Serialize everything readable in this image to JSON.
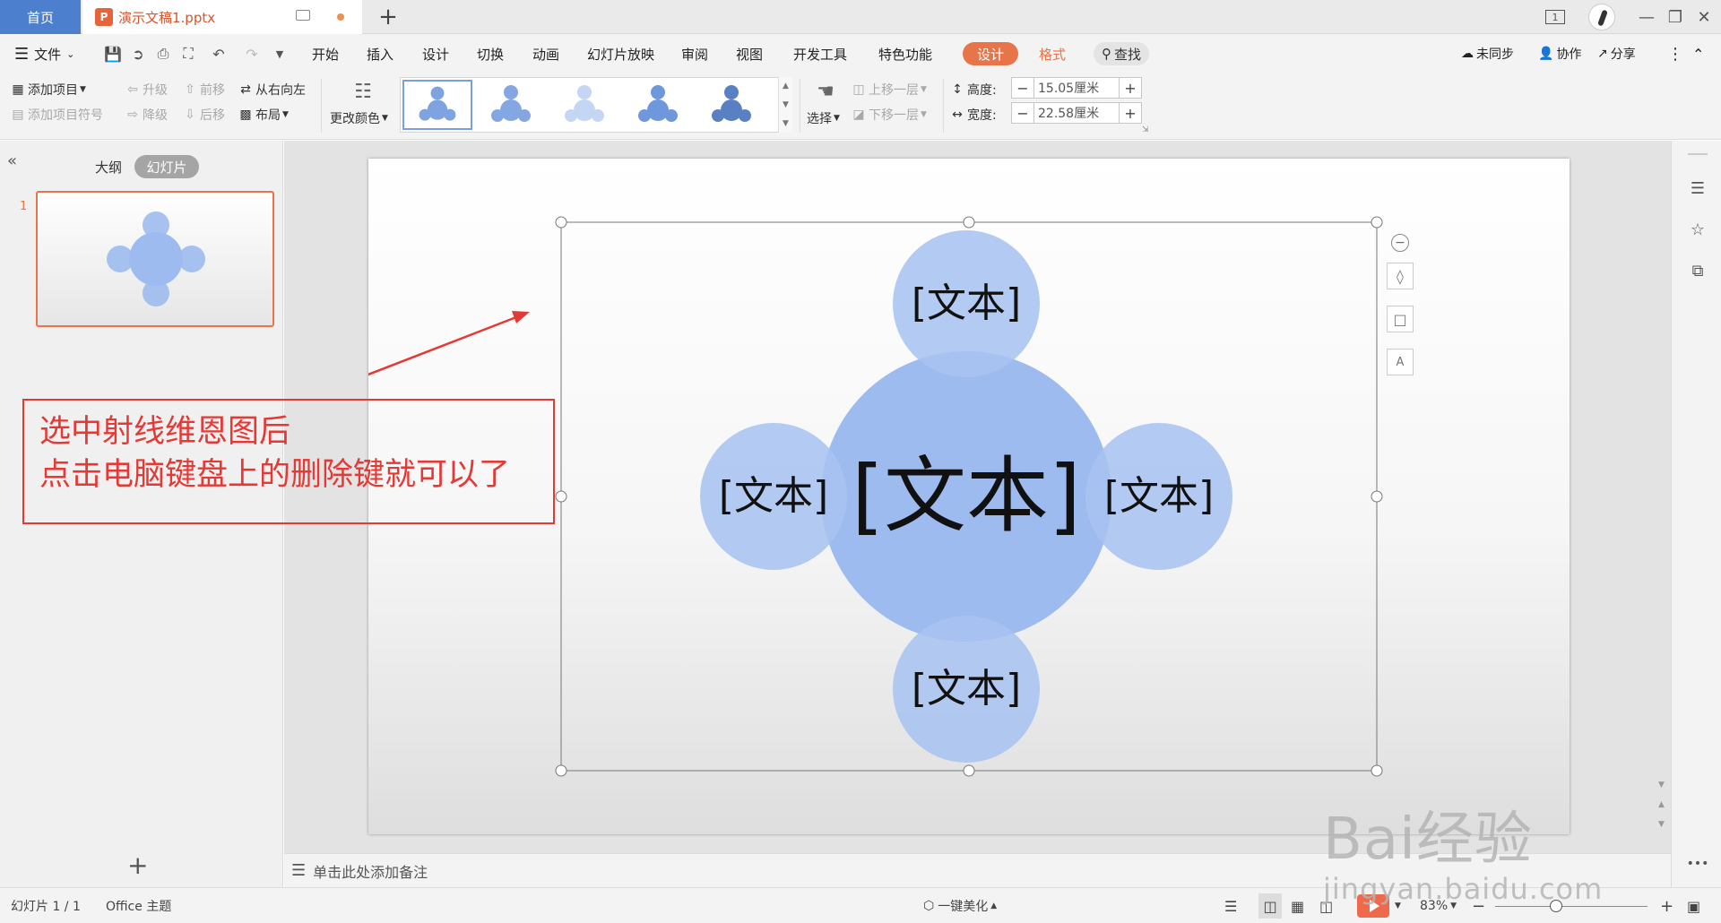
{
  "titlebar": {
    "home_tab": "首页",
    "doc_icon": "P",
    "doc_name": "演示文稿1.pptx",
    "new_tab": "+",
    "page_badge": "1"
  },
  "menu": {
    "file": "文件",
    "tabs": [
      "开始",
      "插入",
      "设计",
      "切换",
      "动画",
      "幻灯片放映",
      "审阅",
      "视图",
      "开发工具",
      "特色功能"
    ],
    "design": "设计",
    "format": "格式",
    "search": "查找",
    "unsynced": "未同步",
    "collaborate": "协作",
    "share": "分享"
  },
  "ribbon": {
    "add_item": "添加项目",
    "add_bullet": "添加项目符号",
    "promote": "升级",
    "demote": "降级",
    "move_forward": "前移",
    "move_backward": "后移",
    "right_to_left": "从右向左",
    "layout": "布局",
    "change_color": "更改颜色",
    "select": "选择",
    "bring_forward": "上移一层",
    "send_backward": "下移一层",
    "height_label": "高度:",
    "height_value": "15.05厘米",
    "width_label": "宽度:",
    "width_value": "22.58厘米"
  },
  "leftpanel": {
    "outline_tab": "大纲",
    "slides_tab": "幻灯片",
    "slide_number": "1"
  },
  "slide": {
    "center_text": "[文本]",
    "top_text": "[文本]",
    "left_text": "[文本]",
    "right_text": "[文本]",
    "bottom_text": "[文本]",
    "annotation_line1": "选中射线维恩图后",
    "annotation_line2": "点击电脑键盘上的删除键就可以了"
  },
  "notes": {
    "placeholder": "单击此处添加备注"
  },
  "statusbar": {
    "slide_count": "幻灯片 1 / 1",
    "theme": "Office 主题",
    "beautify": "一键美化",
    "zoom": "83%"
  },
  "watermark": {
    "line1": "Bai经验",
    "line2": "jingyan.baidu.com"
  },
  "colors": {
    "accent": "#e8744a",
    "home_tab": "#4d7fcf",
    "circle_fill": "#9dbbef",
    "circle_overlap": "#7aa0e6",
    "annotation": "#e53935"
  }
}
